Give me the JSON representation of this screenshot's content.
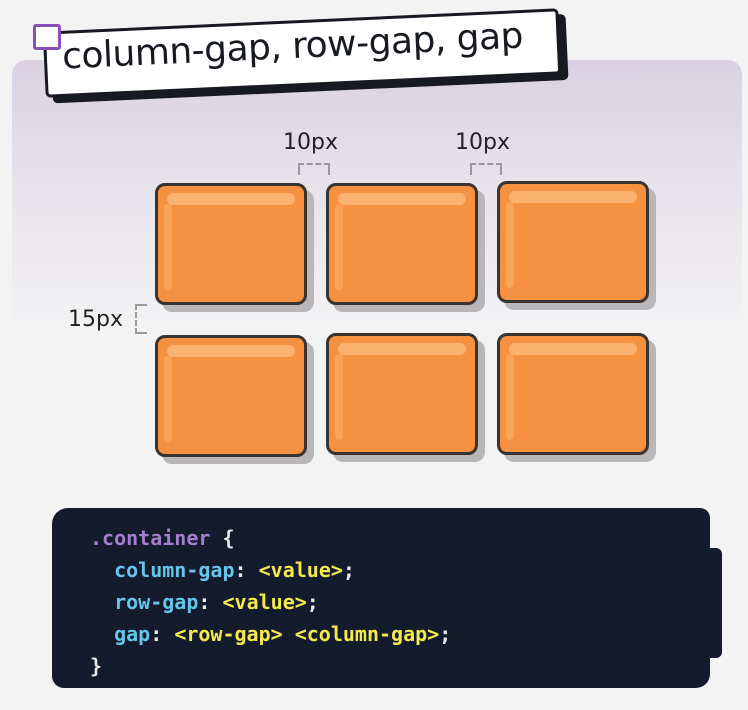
{
  "title": "column-gap, row-gap, gap",
  "colors": {
    "box_fill": "#f59140",
    "box_border": "#3a3430",
    "code_background": "#131b2c",
    "selector": "#a57fcf",
    "property": "#67c4ea",
    "value": "#f5e94e",
    "title_square": "#8a4fb8"
  },
  "grid": {
    "columns": 3,
    "rows": 2,
    "column_gap_labels": [
      "10px",
      "10px"
    ],
    "row_gap_label": "15px"
  },
  "code": {
    "selector": ".container",
    "open_brace": "{",
    "close_brace": "}",
    "lines": [
      {
        "property": "column-gap",
        "colon": ":",
        "value": "<value>",
        "semicolon": ";"
      },
      {
        "property": "row-gap",
        "colon": ":",
        "value": "<value>",
        "semicolon": ";"
      },
      {
        "property": "gap",
        "colon": ":",
        "value": "<row-gap> <column-gap>",
        "semicolon": ";"
      }
    ]
  }
}
